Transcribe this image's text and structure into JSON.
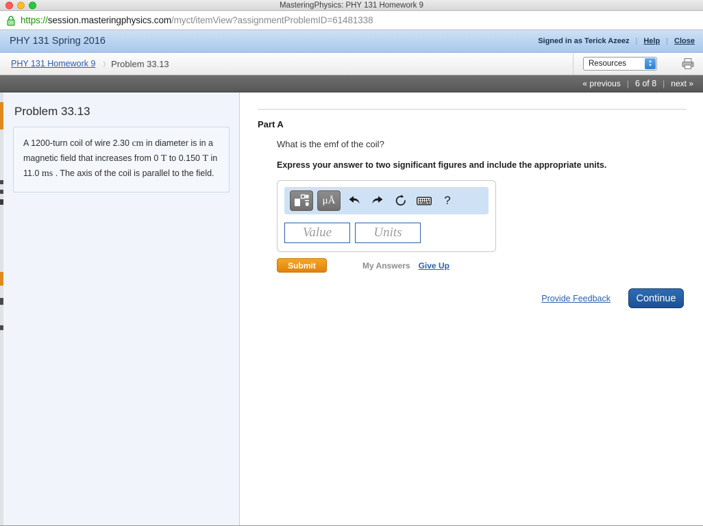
{
  "window": {
    "title": "MasteringPhysics: PHY 131 Homework 9",
    "traffic_lights": [
      "close",
      "minimize",
      "zoom"
    ]
  },
  "urlbar": {
    "scheme": "https://",
    "host": "session.masteringphysics.com",
    "path": "/myct/itemView?assignmentProblemID=61481338",
    "lock_icon": "lock-icon",
    "secure": true
  },
  "header": {
    "course_title": "PHY 131 Spring 2016",
    "signed_in_as": "Signed in as Terick Azeez",
    "help_label": "Help",
    "close_label": "Close",
    "separator": "|"
  },
  "breadcrumb": {
    "parent_label": "PHY 131 Homework 9",
    "separator": "›",
    "current_label": "Problem 33.13",
    "resources_select": {
      "selected": "Resources",
      "stepper_up": "▴",
      "stepper_down": "▾"
    },
    "print_icon": "printer-icon"
  },
  "navstrip": {
    "previous_label": "« previous",
    "page_indicator": "6 of 8",
    "next_label": "next »",
    "separator": "|"
  },
  "left_panel": {
    "problem_title": "Problem 33.13",
    "statement": {
      "seg1": "A 1200-turn coil of wire 2.30 ",
      "unit1": "cm",
      "seg2": " in diameter is in a magnetic field that increases from 0 ",
      "unit2": "T",
      "seg3": " to 0.150 ",
      "unit3": "T",
      "seg4": " in 11.0 ",
      "unit4": "ms",
      "seg5": " . The axis of the coil is parallel to the field."
    }
  },
  "main_panel": {
    "part_label": "Part A",
    "question": "What is the emf of the coil?",
    "instruction": "Express your answer to two significant figures and include the appropriate units.",
    "answer_widget": {
      "toolbar": [
        {
          "name": "math-template-icon",
          "label": ""
        },
        {
          "name": "units-icon",
          "label": "μÅ"
        },
        {
          "name": "undo-icon",
          "label": ""
        },
        {
          "name": "redo-icon",
          "label": ""
        },
        {
          "name": "reset-icon",
          "label": ""
        },
        {
          "name": "keyboard-icon",
          "label": ""
        },
        {
          "name": "help-icon",
          "label": "?"
        }
      ],
      "value_placeholder": "Value",
      "units_placeholder": "Units",
      "value_current": "",
      "units_current": ""
    },
    "submit_label": "Submit",
    "my_answers_label": "My Answers",
    "give_up_label": "Give Up",
    "provide_feedback_label": "Provide Feedback",
    "continue_label": "Continue"
  },
  "colors": {
    "header_blue": "#a8c8ec",
    "toolbar_blue": "#cfe2f5",
    "submit_orange": "#e2820d",
    "continue_blue": "#1d5196",
    "link_blue": "#2b5faa",
    "panel_bg": "#f1f5fb",
    "navstrip_gray": "#575757"
  }
}
